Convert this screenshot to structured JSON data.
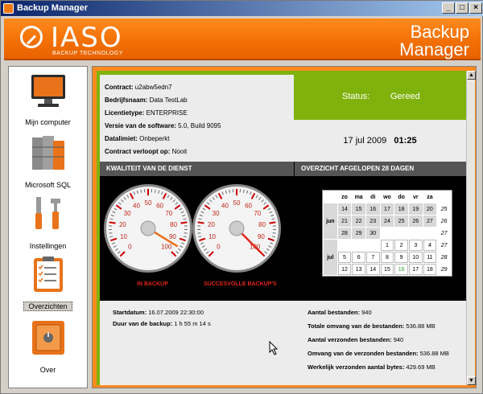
{
  "window": {
    "title": "Backup Manager",
    "minimize": "_",
    "maximize": "□",
    "close": "×"
  },
  "header": {
    "logo": "IASO",
    "logo_sub": "BACKUP TECHNOLOGY",
    "product_line1": "Backup",
    "product_line2": "Manager"
  },
  "sidebar": {
    "items": [
      {
        "label": "Mijn computer",
        "icon": "monitor-icon"
      },
      {
        "label": "Microsoft SQL",
        "icon": "database-icon"
      },
      {
        "label": "Instellingen",
        "icon": "tools-icon"
      },
      {
        "label": "Overzichten",
        "icon": "clipboard-icon",
        "active": true
      },
      {
        "label": "Over",
        "icon": "safe-icon"
      }
    ]
  },
  "info": {
    "contract_label": "Contract:",
    "contract": "u2abw5edn7",
    "company_label": "Bedrijfsnaam:",
    "company": "Data TestLab",
    "license_label": "Licentietype:",
    "license": "ENTERPRISE",
    "version_label": "Versie van de software:",
    "version": "5.0, Build 9095",
    "datalimit_label": "Datalimiet:",
    "datalimit": "Onbeperkt",
    "expiry_label": "Contract verloopt op:",
    "expiry": "Nooit"
  },
  "status": {
    "label": "Status:",
    "value": "Gereed",
    "date": "17 jul 2009",
    "time": "01:25"
  },
  "sections": {
    "quality": "KWALITEIT VAN DE DIENST",
    "overview": "OVERZICHT AFGELOPEN 28 DAGEN"
  },
  "gauges": {
    "ticks": [
      "0",
      "10",
      "20",
      "30",
      "40",
      "50",
      "60",
      "70",
      "80",
      "90",
      "100"
    ],
    "in_backup": {
      "label": "IN BACKUP",
      "value": 95
    },
    "success": {
      "label": "SUCCESVOLLE BACKUP'S",
      "value": 100
    }
  },
  "calendar": {
    "days": [
      "zo",
      "ma",
      "di",
      "wo",
      "do",
      "vr",
      "za"
    ],
    "months": [
      "jun",
      "jul"
    ],
    "jun_rows": [
      {
        "cells": [
          "14",
          "15",
          "16",
          "17",
          "18",
          "19",
          "20"
        ],
        "week": "25"
      },
      {
        "cells": [
          "21",
          "22",
          "23",
          "24",
          "25",
          "26",
          "27"
        ],
        "week": "26"
      },
      {
        "cells": [
          "28",
          "29",
          "30",
          "",
          "",
          "",
          ""
        ],
        "week": "27"
      }
    ],
    "jul_rows": [
      {
        "cells": [
          "",
          "",
          "",
          "1",
          "2",
          "3",
          "4"
        ],
        "week": "27"
      },
      {
        "cells": [
          "5",
          "6",
          "7",
          "8",
          "9",
          "10",
          "11"
        ],
        "week": "28"
      },
      {
        "cells": [
          "12",
          "13",
          "14",
          "15",
          "16",
          "17",
          "18"
        ],
        "week": "29"
      }
    ]
  },
  "stats": {
    "start_label": "Startdatum:",
    "start": "16.07.2009 22:30:00",
    "duration_label": "Duur van de backup:",
    "duration": "1 h 55 m 14 s",
    "files_label": "Aantal bestanden:",
    "files": "940",
    "size_label": "Totale omvang van de bestanden:",
    "size": "536.88 MB",
    "sent_label": "Aantal verzonden bestanden:",
    "sent": "940",
    "sent_size_label": "Omvang van de verzonden bestanden:",
    "sent_size": "536.88 MB",
    "bytes_label": "Werkelijk verzonden aantal bytes:",
    "bytes": "429.69 MB"
  }
}
